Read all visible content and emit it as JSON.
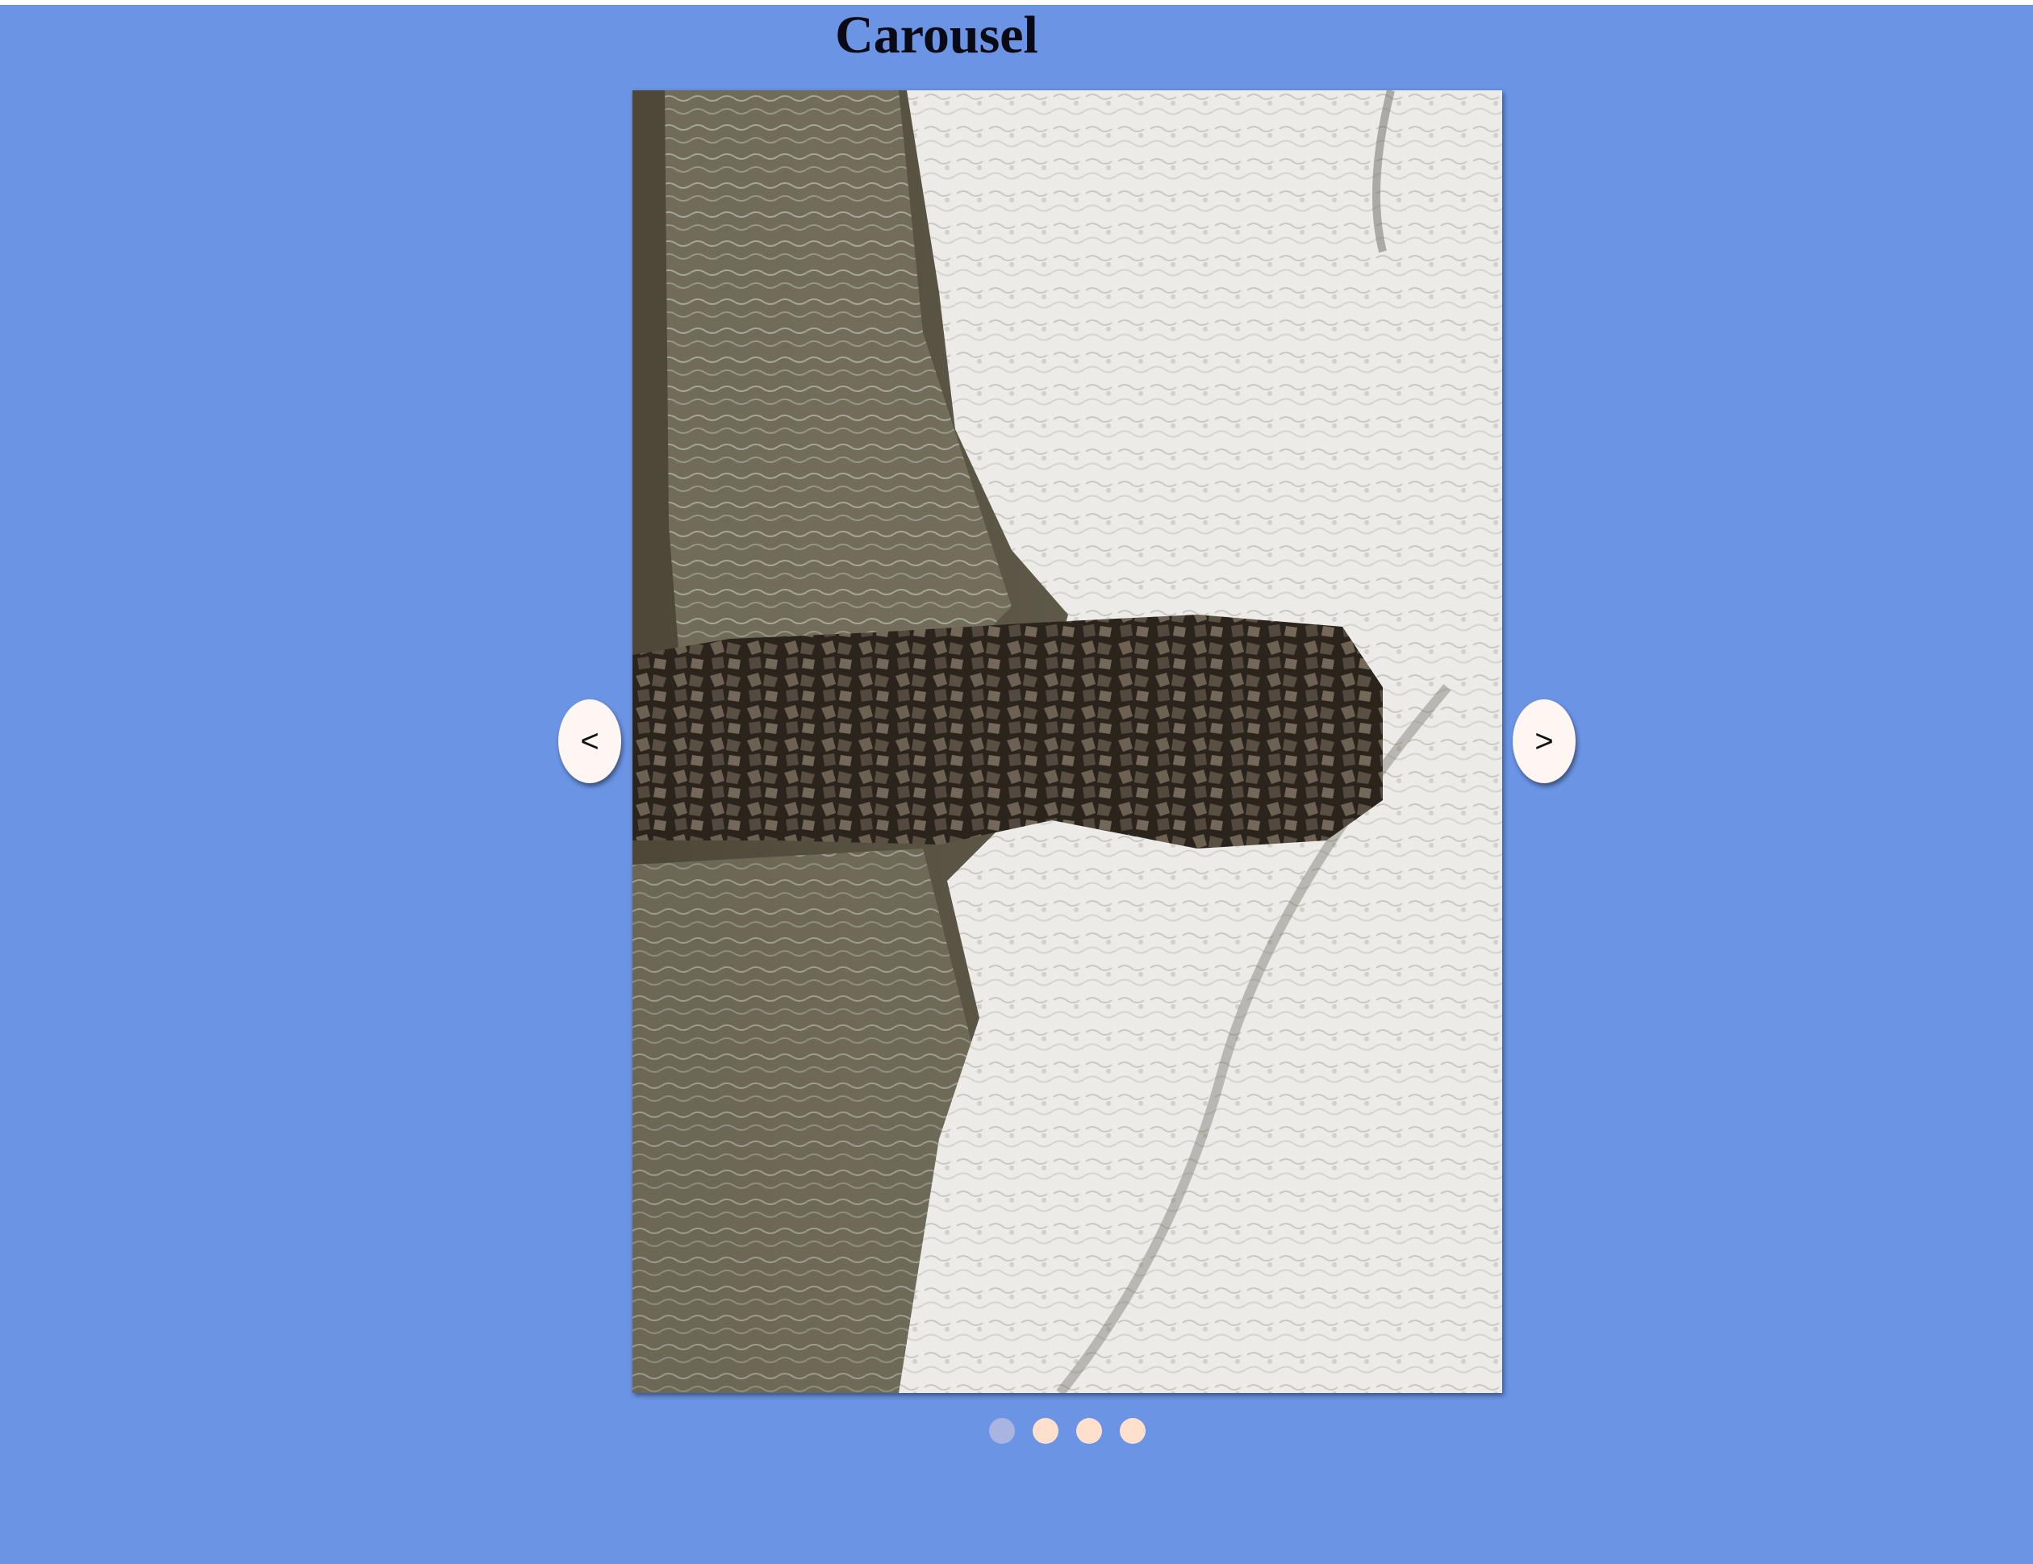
{
  "page": {
    "title": "Carousel",
    "background": "#6b94e5"
  },
  "carousel": {
    "prev_label": "<",
    "next_label": ">",
    "slide_count": 4,
    "active_index": 0,
    "dot_color": "#ffe0cc",
    "active_dot_color": "#aab4e0",
    "slide_description_icon": "aerial-ocean-rock-jetty-image"
  }
}
